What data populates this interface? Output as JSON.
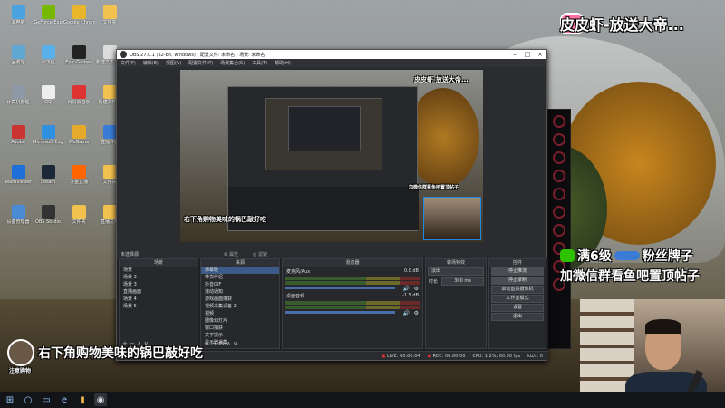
{
  "desktop_icons": [
    {
      "label": "此电脑",
      "color": "#4aa3df"
    },
    {
      "label": "回收站",
      "color": "#5fa8d3"
    },
    {
      "label": "计算机管理",
      "color": "#8d9aa6"
    },
    {
      "label": "Adobe",
      "color": "#c33"
    },
    {
      "label": "TeamViewer",
      "color": "#1e6fd9"
    },
    {
      "label": "设备管理器",
      "color": "#4a8bd6"
    },
    {
      "label": "GeForce Exp",
      "color": "#76b900"
    },
    {
      "label": "小飞机",
      "color": "#5ab0e8"
    },
    {
      "label": "QQ",
      "color": "#eee"
    },
    {
      "label": "Microsoft Edge",
      "color": "#2f8fe0"
    },
    {
      "label": "Steam",
      "color": "#1b2838"
    },
    {
      "label": "OBS Studio",
      "color": "#333"
    },
    {
      "label": "Google Chrome",
      "color": "#e9b52b"
    },
    {
      "label": "Epic Games",
      "color": "#222"
    },
    {
      "label": "网易云音乐",
      "color": "#d33"
    },
    {
      "label": "WeGame",
      "color": "#e5a92c"
    },
    {
      "label": "斗鱼直播",
      "color": "#f60"
    },
    {
      "label": "文件夹",
      "color": "#f2c14e"
    },
    {
      "label": "文件夹",
      "color": "#f2c14e"
    },
    {
      "label": "新建文本文档",
      "color": "#ddd"
    },
    {
      "label": "新建文件夹",
      "color": "#f2c14e"
    },
    {
      "label": "直播伴侣",
      "color": "#3a7bd5"
    },
    {
      "label": "文件夹",
      "color": "#f2c14e"
    },
    {
      "label": "直播文件",
      "color": "#f2c14e"
    }
  ],
  "taskbar": {
    "start": "⊞",
    "search": "○",
    "task": "▭",
    "edge": "e",
    "explorer": "▮",
    "obs": "◉"
  },
  "obs": {
    "title": "OBS 27.0.1 (32-bit, windows) - 配置文件: 未命名 - 场景: 未命名",
    "menu": [
      "文件(F)",
      "编辑(E)",
      "视图(V)",
      "配置文件(P)",
      "场景集合(S)",
      "工具(T)",
      "帮助(H)"
    ],
    "preview_label": "未选择源",
    "tabs": {
      "props": "属性",
      "filters": "滤镜"
    },
    "scenes": {
      "header": "场景",
      "items": [
        "场景",
        "场景 2",
        "场景 3",
        "直播画面",
        "场景 4",
        "场景 5"
      ]
    },
    "sources": {
      "header": "来源",
      "items": [
        "弹幕姬",
        "带货伴侣",
        "抖音GIF",
        "滚动通知",
        "游戏画面捕获",
        "视频采集设备 2",
        "视频",
        "图像幻灯片",
        "窗口捕获",
        "文字提示",
        "显示器采集"
      ]
    },
    "mixer": {
      "header": "混音器",
      "channels": [
        {
          "name": "麦克风/Aux",
          "db": "0.0 dB"
        },
        {
          "name": "桌面音频",
          "db": "-1.5 dB"
        }
      ]
    },
    "transitions": {
      "header": "转场特效",
      "type": "淡出",
      "duration_label": "时长",
      "duration": "300 ms"
    },
    "controls": {
      "header": "控件",
      "buttons": [
        "停止推流",
        "停止录制",
        "启动虚拟摄像机",
        "工作室模式",
        "设置",
        "退出"
      ]
    },
    "status": {
      "live": "LIVE: 00:00:04",
      "rec": "REC: 00:00:00",
      "cpu": "CPU: 1.2%, 60.00 fps",
      "kbps": "kb/s: 0"
    }
  },
  "overlays": {
    "top_right": "皮皮虾-放送大帝...",
    "wechat_line1": "满6级",
    "wechat_line1b": "粉丝牌子",
    "wechat_line2": "加微信群看鱼吧置顶帖子",
    "bottom_left": "右下角购物美味的锅巴敲好吃",
    "bottom_badge": "注意购物"
  }
}
